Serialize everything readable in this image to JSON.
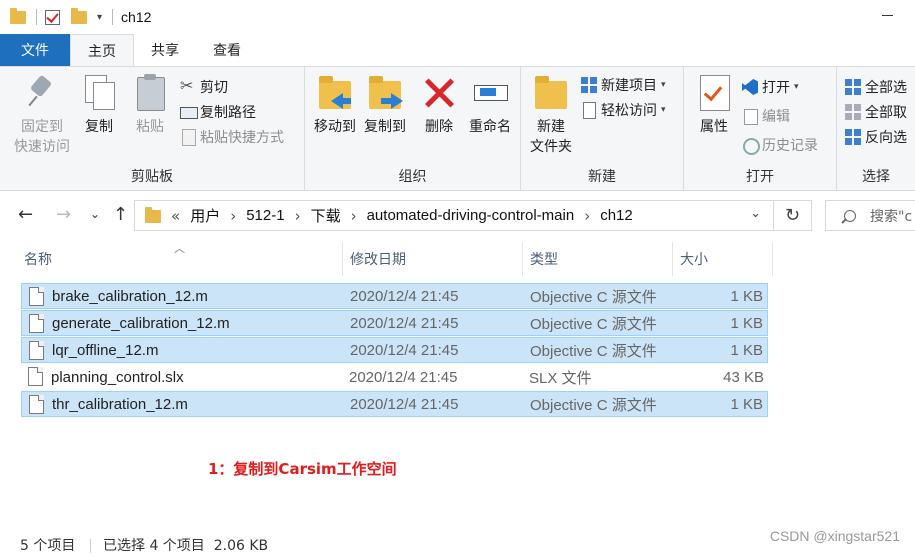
{
  "window": {
    "title": "ch12",
    "quick_access_dropdown": "▾"
  },
  "tabs": [
    {
      "label": "文件"
    },
    {
      "label": "主页"
    },
    {
      "label": "共享"
    },
    {
      "label": "查看"
    }
  ],
  "ribbon": {
    "clipboard": {
      "label": "剪贴板",
      "pin": "固定到\n快速访问",
      "pin_l1": "固定到",
      "pin_l2": "快速访问",
      "copy": "复制",
      "paste": "粘贴",
      "cut": "剪切",
      "copy_path": "复制路径",
      "paste_shortcut": "粘贴快捷方式"
    },
    "organize": {
      "label": "组织",
      "move_to": "移动到",
      "copy_to": "复制到",
      "delete": "删除",
      "rename": "重命名"
    },
    "new": {
      "label": "新建",
      "new_folder_l1": "新建",
      "new_folder_l2": "文件夹",
      "new_item": "新建项目",
      "easy_access": "轻松访问"
    },
    "open": {
      "label": "打开",
      "properties": "属性",
      "open": "打开",
      "edit": "编辑",
      "history": "历史记录"
    },
    "select": {
      "label": "选择",
      "select_all": "全部选",
      "select_none": "全部取",
      "invert": "反向选"
    }
  },
  "address": {
    "prefix": "«",
    "crumbs": [
      "用户",
      "512-1",
      "下载",
      "automated-driving-control-main",
      "ch12"
    ],
    "search_placeholder": "搜索\"c"
  },
  "columns": {
    "name": "名称",
    "date": "修改日期",
    "type": "类型",
    "size": "大小"
  },
  "files": [
    {
      "name": "brake_calibration_12.m",
      "date": "2020/12/4 21:45",
      "type": "Objective C 源文件",
      "size": "1 KB",
      "selected": true
    },
    {
      "name": "generate_calibration_12.m",
      "date": "2020/12/4 21:45",
      "type": "Objective C 源文件",
      "size": "1 KB",
      "selected": true
    },
    {
      "name": "lqr_offline_12.m",
      "date": "2020/12/4 21:45",
      "type": "Objective C 源文件",
      "size": "1 KB",
      "selected": true
    },
    {
      "name": "planning_control.slx",
      "date": "2020/12/4 21:45",
      "type": "SLX 文件",
      "size": "43 KB",
      "selected": false
    },
    {
      "name": "thr_calibration_12.m",
      "date": "2020/12/4 21:45",
      "type": "Objective C 源文件",
      "size": "1 KB",
      "selected": true
    }
  ],
  "annotation": "1：复制到Carsim工作空间",
  "status": {
    "item_count": "5 个项目",
    "selection": "已选择 4 个项目  2.06 KB"
  },
  "watermark": "CSDN @xingstar521",
  "colors": {
    "file_tab": "#1e6fbd",
    "selection_bg": "#cce4f7",
    "selection_border": "#99d1ff",
    "annotation": "#e41b1b",
    "delete_icon": "#d8262a"
  }
}
